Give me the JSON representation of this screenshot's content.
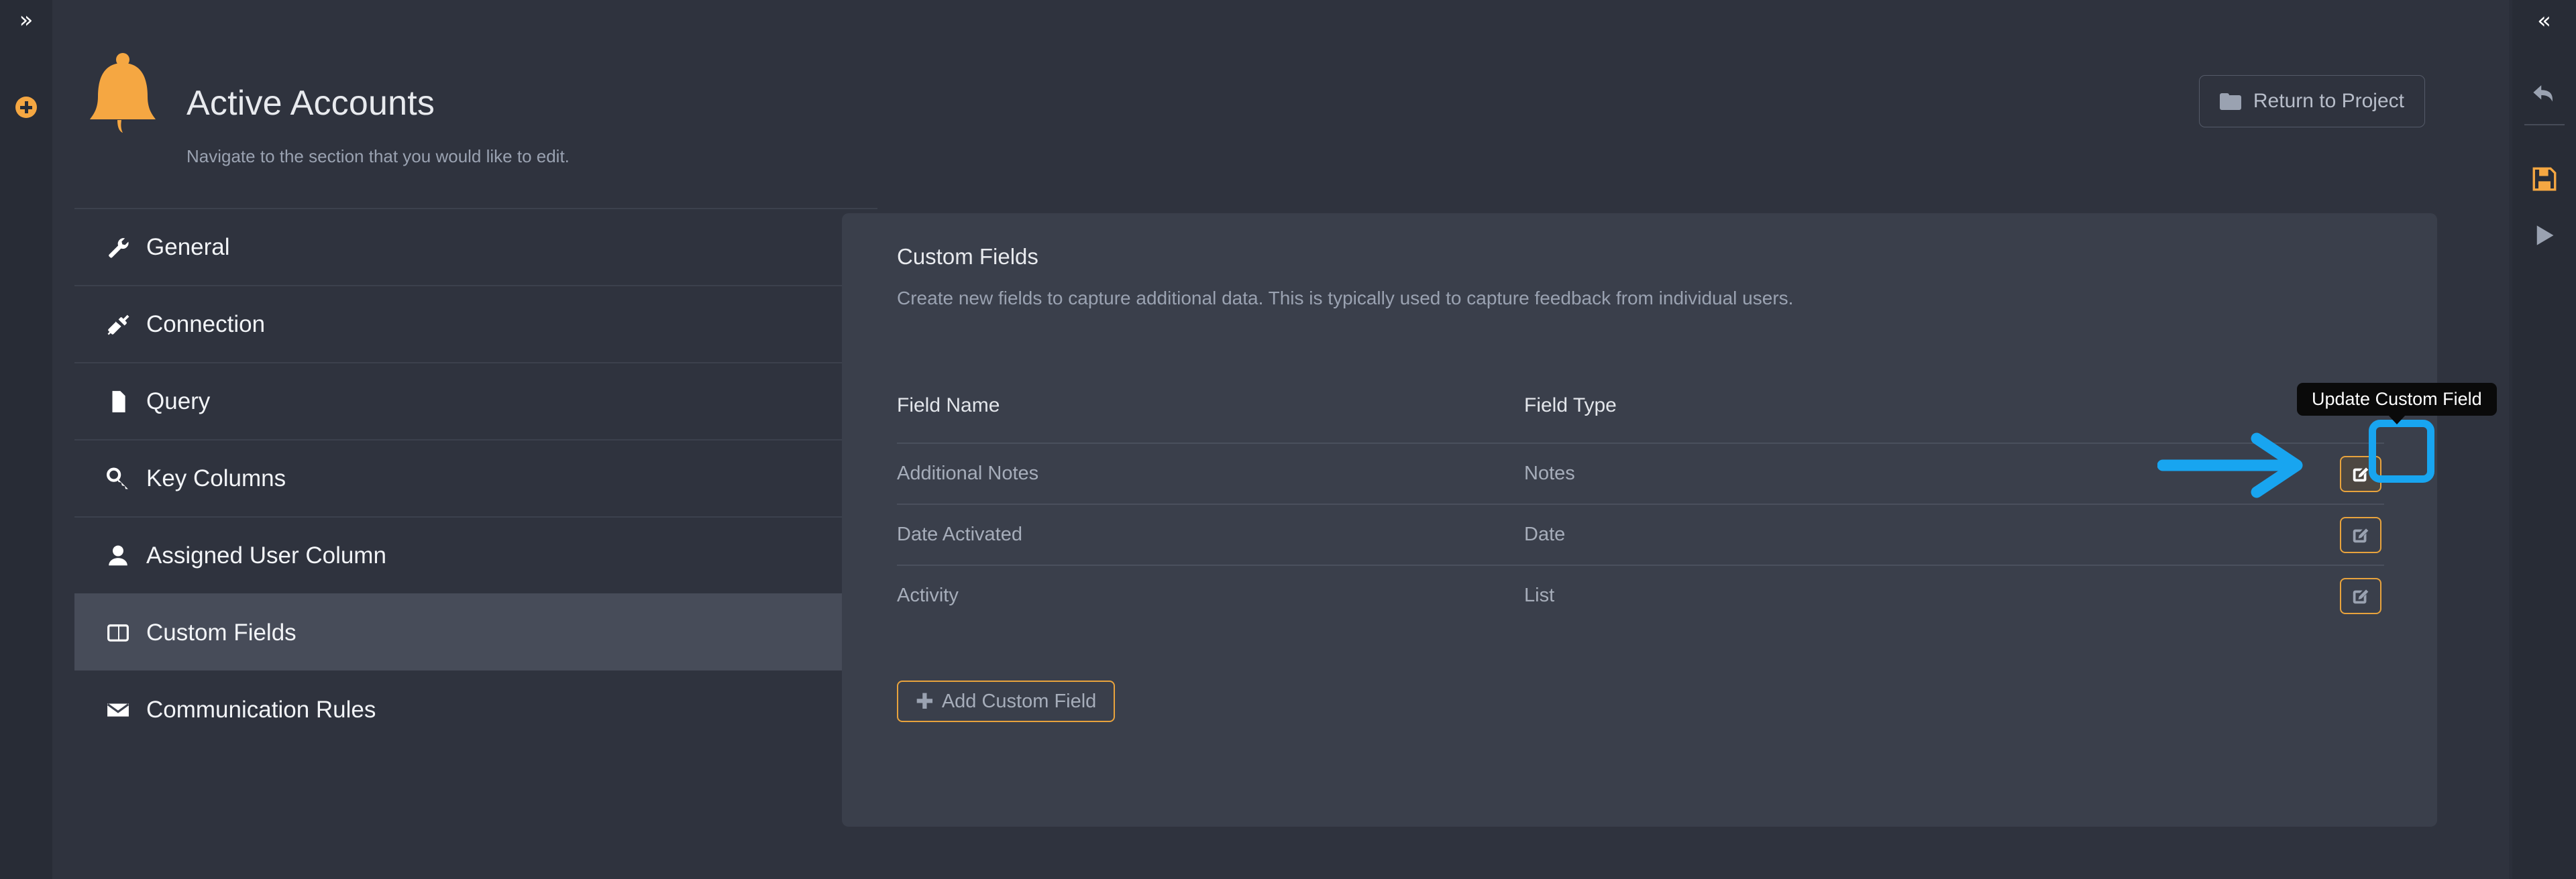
{
  "colors": {
    "page_bg": "#2f333e",
    "rail_bg": "#282c36",
    "panel_bg": "#3a3f4b",
    "accent_orange": "#e8a33d",
    "bell_orange": "#f5a742",
    "annotation_blue": "#18a5f0",
    "selected_nav": "#474c59",
    "tooltip_bg": "#0a0a0a",
    "text_primary": "#e8eaee",
    "text_muted": "#9aa2b1"
  },
  "left_rail": {
    "expand_icon": "chevron-double-right-icon",
    "add_icon": "plus-circle-icon"
  },
  "header": {
    "icon": "bell-icon",
    "title": "Active Accounts",
    "subtitle": "Navigate to the section that you would like to edit.",
    "return_button": {
      "label": "Return to Project",
      "icon": "folder-icon"
    }
  },
  "nav": {
    "items": [
      {
        "label": "General",
        "icon": "wrench-icon",
        "selected": false
      },
      {
        "label": "Connection",
        "icon": "plug-icon",
        "selected": false
      },
      {
        "label": "Query",
        "icon": "file-icon",
        "selected": false
      },
      {
        "label": "Key Columns",
        "icon": "key-icon",
        "selected": false
      },
      {
        "label": "Assigned User Column",
        "icon": "user-icon",
        "selected": false
      },
      {
        "label": "Custom Fields",
        "icon": "columns-icon",
        "selected": true
      },
      {
        "label": "Communication Rules",
        "icon": "envelope-icon",
        "selected": false
      }
    ]
  },
  "panel": {
    "title": "Custom Fields",
    "description": "Create new fields to capture additional data. This is typically used to capture feedback from individual users.",
    "table": {
      "columns": [
        "Field Name",
        "Field Type",
        ""
      ],
      "rows": [
        {
          "field_name": "Additional Notes",
          "field_type": "Notes",
          "action_icon": "edit-icon",
          "hovered": true
        },
        {
          "field_name": "Date Activated",
          "field_type": "Date",
          "action_icon": "edit-icon",
          "hovered": false
        },
        {
          "field_name": "Activity",
          "field_type": "List",
          "action_icon": "edit-icon",
          "hovered": false
        }
      ]
    },
    "add_button": {
      "label": "Add Custom Field",
      "icon": "plus-icon"
    }
  },
  "tooltip": {
    "text": "Update Custom Field"
  },
  "annotations": {
    "arrow": "blue-arrow-pointing-right",
    "ring": "blue-highlight-ring"
  },
  "right_rail": {
    "items": [
      {
        "icon": "chevron-double-left-icon",
        "name": "collapse-panel-button"
      },
      {
        "icon": "undo-arrow-icon",
        "name": "undo-button"
      },
      {
        "icon": "save-disk-icon",
        "name": "save-button"
      },
      {
        "icon": "play-triangle-icon",
        "name": "run-button"
      }
    ]
  }
}
